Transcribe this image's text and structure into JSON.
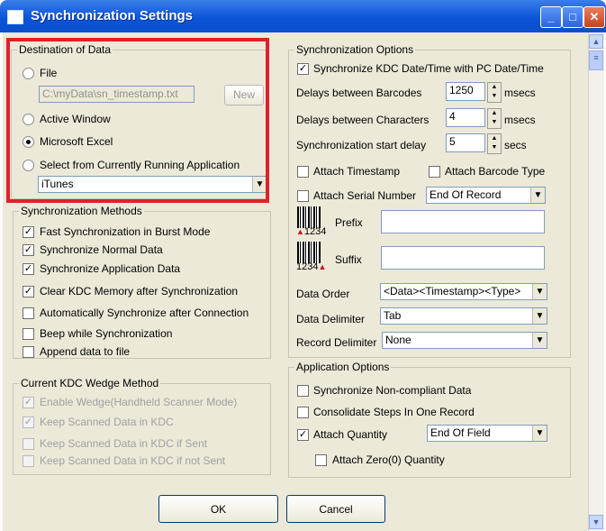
{
  "window": {
    "title": "Synchronization Settings",
    "controls": [
      "_",
      "□",
      "✕"
    ]
  },
  "destination": {
    "legend": "Destination of Data",
    "file_label": "File",
    "file_path": "C:\\myData\\sn_timestamp.txt",
    "new_button": "New",
    "active_window_label": "Active Window",
    "excel_label": "Microsoft Excel",
    "running_app_label": "Select from Currently Running Application",
    "running_app_value": "iTunes",
    "selected": "Microsoft Excel"
  },
  "sync_methods": {
    "legend": "Synchronization Methods",
    "items": [
      {
        "label": "Fast Synchronization in Burst Mode",
        "checked": true
      },
      {
        "label": "Synchronize Normal Data",
        "checked": true
      },
      {
        "label": "Synchronize Application Data",
        "checked": true
      },
      {
        "label": "Clear KDC Memory after Synchronization",
        "checked": true
      },
      {
        "label": "Automatically Synchronize after Connection",
        "checked": false
      },
      {
        "label": "Beep while Synchronization",
        "checked": false
      },
      {
        "label": "Append data to file",
        "checked": false
      }
    ]
  },
  "wedge": {
    "legend": "Current KDC Wedge Method",
    "items": [
      {
        "label": "Enable Wedge(Handheld Scanner Mode)",
        "checked": true
      },
      {
        "label": "Keep Scanned Data in KDC",
        "checked": true
      },
      {
        "label": "Keep Scanned Data in KDC if Sent",
        "checked": false
      },
      {
        "label": "Keep Scanned Data in KDC if not Sent",
        "checked": false
      }
    ]
  },
  "sync_options": {
    "legend": "Synchronization Options",
    "sync_datetime_label": "Synchronize KDC Date/Time with PC Date/Time",
    "sync_datetime_checked": true,
    "delay_barcodes_label": "Delays between Barcodes",
    "delay_barcodes_value": "1250",
    "delay_chars_label": "Delays between Characters",
    "delay_chars_value": "4",
    "start_delay_label": "Synchronization start delay",
    "start_delay_value": "5",
    "msecs": "msecs",
    "secs": "secs",
    "attach_timestamp_label": "Attach Timestamp",
    "attach_barcode_type_label": "Attach Barcode Type",
    "attach_serial_label": "Attach Serial Number",
    "serial_position": "End Of Record",
    "prefix_label": "Prefix",
    "prefix_value": "",
    "suffix_label": "Suffix",
    "suffix_value": "",
    "barcode_number": "1234",
    "data_order_label": "Data Order",
    "data_order_value": "<Data><Timestamp><Type>",
    "data_delimiter_label": "Data Delimiter",
    "data_delimiter_value": "Tab",
    "record_delimiter_label": "Record Delimiter",
    "record_delimiter_value": "None"
  },
  "app_options": {
    "legend": "Application Options",
    "noncompliant_label": "Synchronize Non-compliant Data",
    "consolidate_label": "Consolidate Steps In One Record",
    "attach_quantity_label": "Attach Quantity",
    "attach_quantity_checked": true,
    "quantity_position": "End Of Field",
    "attach_zero_label": "Attach Zero(0) Quantity"
  },
  "buttons": {
    "ok": "OK",
    "cancel": "Cancel"
  },
  "colors": {
    "highlight": "#e0202b",
    "titlebar": "#0b55d9",
    "dialog": "#ece9d8"
  }
}
